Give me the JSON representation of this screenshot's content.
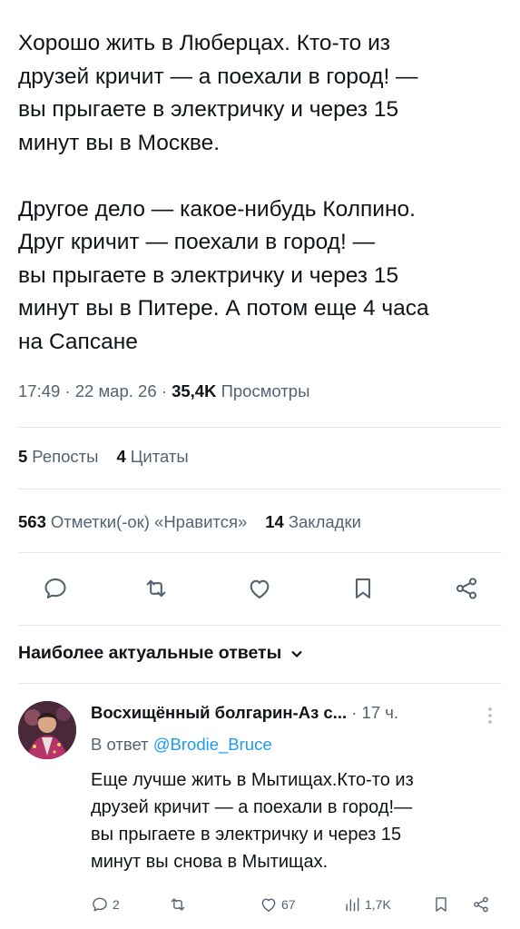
{
  "tweet": {
    "text": "Хорошо жить в Люберцах. Кто-то из\nдрузей кричит — а поехали в город! —\nвы прыгаете в электричку и через 15\nминут вы в Москве.\n\nДругое дело — какое-нибудь Колпино.\nДруг кричит — поехали в город! —\nвы прыгаете в электричку и через 15\nминут вы в Питере. А потом еще 4 часа\nна Сапсане",
    "time": "17:49",
    "date": "22 мар. 26",
    "separator": "·",
    "views_count": "35,4K",
    "views_label": "Просмотры"
  },
  "stats": {
    "reposts_count": "5",
    "reposts_label": "Репосты",
    "quotes_count": "4",
    "quotes_label": "Цитаты",
    "likes_count": "563",
    "likes_label": "Отметки(-ок) «Нравится»",
    "bookmarks_count": "14",
    "bookmarks_label": "Закладки"
  },
  "actions": [
    "reply-icon",
    "repost-icon",
    "like-icon",
    "bookmark-icon",
    "share-icon"
  ],
  "replies_header": {
    "label": "Наиболее актуальные ответы",
    "icon": "chevron-down-icon"
  },
  "reply": {
    "name": "Восхищённый болгарин-Аз с...",
    "time": "· 17 ч.",
    "reply_to_label": "В ответ",
    "reply_to_handle": "@Brodie_Bruce",
    "text": "Еще лучше жить в Мытищах.Кто-то из\nдрузей кричит — а поехали в город!—\nвы прыгаете в электричку и через 15\nминут вы снова в Мытищах.",
    "replies_count": "2",
    "reposts_count": "",
    "likes_count": "67",
    "views_count": "1,7K"
  },
  "colors": {
    "text": "#0f1419",
    "secondary": "#536471",
    "link": "#1d9bf0",
    "divider": "#e6e9ec"
  }
}
